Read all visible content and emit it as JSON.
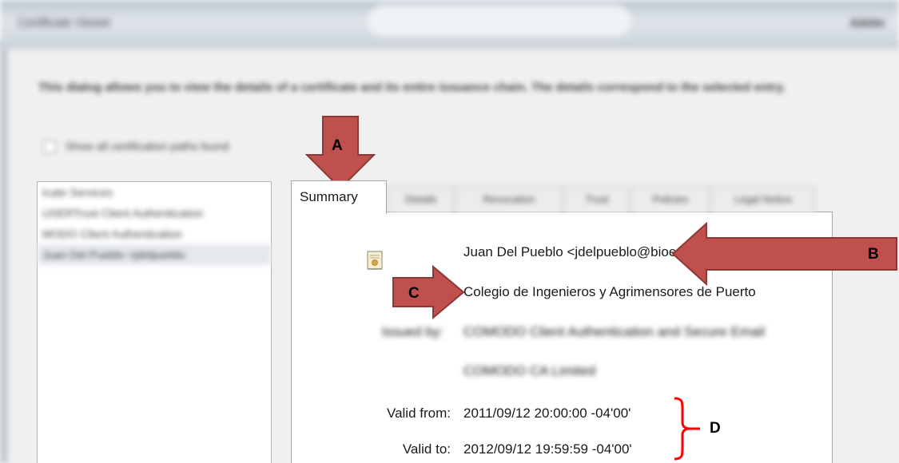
{
  "window": {
    "title": "Certificate Viewer",
    "title_right": "Adobe"
  },
  "intro_text": "This dialog allows you to view the details of a certificate and its entire issuance chain. The details correspond to the selected entry.",
  "show_all_paths_label": "Show all certification paths found",
  "certificate_path": [
    {
      "label": "Icate Services"
    },
    {
      "label": "USERTrust Client Authentication"
    },
    {
      "label": "MODO Client Authentication"
    },
    {
      "label": "Juan Del Pueblo <jdelpueblo"
    }
  ],
  "tabs": [
    {
      "label": "Summary",
      "active": true
    },
    {
      "label": "Details"
    },
    {
      "label": "Revocation"
    },
    {
      "label": "Trust"
    },
    {
      "label": "Policies"
    },
    {
      "label": "Legal Notice"
    }
  ],
  "summary": {
    "subject": "Juan  Del Pueblo <jdelpueblo@bioesign.com>",
    "organization": "Colegio de Ingenieros y Agrimensores de Puerto",
    "issued_by_label": "Issued by:",
    "issued_by_line1": "COMODO Client Authentication and Secure Email",
    "issued_by_line2": "COMODO CA Limited",
    "valid_from_label": "Valid from:",
    "valid_from": "2011/09/12 20:00:00 -04'00'",
    "valid_to_label": "Valid to:",
    "valid_to": "2012/09/12 19:59:59 -04'00'"
  },
  "annotations": {
    "a": "A",
    "b": "B",
    "c": "C",
    "d": "D"
  },
  "colors": {
    "arrow_fill": "#c0504d",
    "arrow_stroke": "#8c3836",
    "brace": "#ff0000"
  }
}
